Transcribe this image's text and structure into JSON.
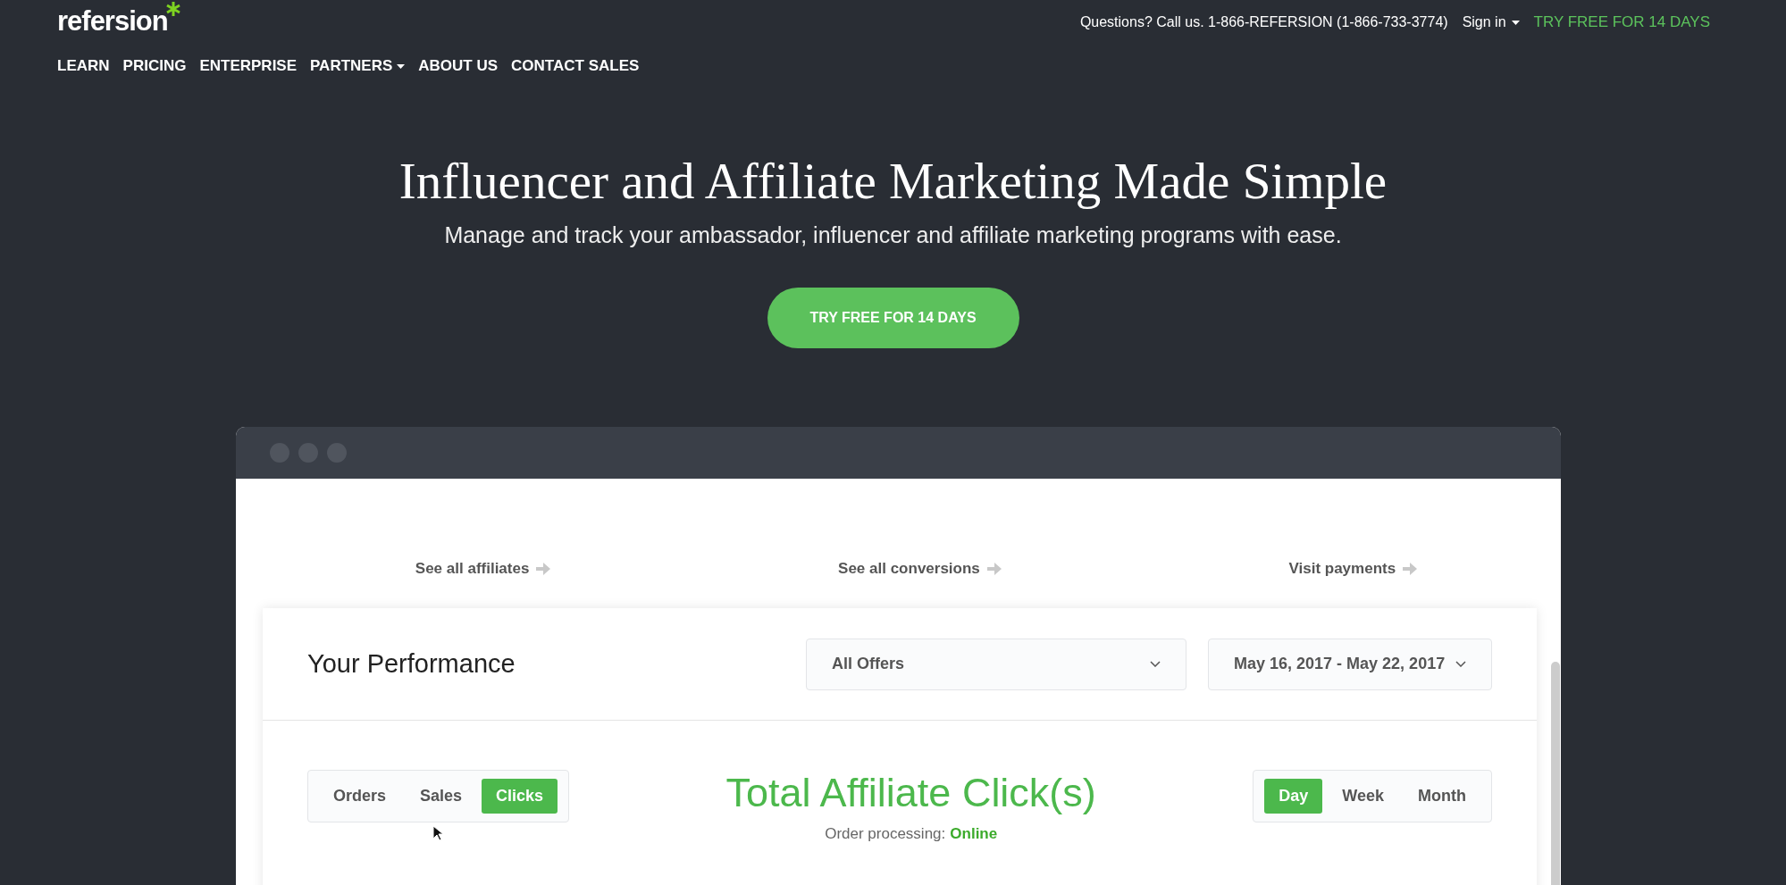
{
  "header": {
    "logo": "refersion",
    "contact": "Questions? Call us. 1-866-REFERSION (1-866-733-3774)",
    "sign_in": "Sign in",
    "cta": "TRY FREE FOR 14 DAYS"
  },
  "nav": [
    {
      "label": "LEARN",
      "dropdown": false
    },
    {
      "label": "PRICING",
      "dropdown": false
    },
    {
      "label": "ENTERPRISE",
      "dropdown": false
    },
    {
      "label": "PARTNERS",
      "dropdown": true
    },
    {
      "label": "ABOUT US",
      "dropdown": false
    },
    {
      "label": "CONTACT SALES",
      "dropdown": false
    }
  ],
  "hero": {
    "title": "Influencer and Affiliate Marketing Made Simple",
    "subtitle": "Manage and track your ambassador, influencer and affiliate marketing programs with ease.",
    "button": "TRY FREE FOR 14 DAYS"
  },
  "app_window": {
    "links": [
      "See all affiliates",
      "See all conversions",
      "Visit payments"
    ],
    "performance": {
      "title": "Your Performance",
      "offer_select": "All Offers",
      "date_select": "May 16, 2017 - May 22, 2017",
      "metric_tabs": [
        {
          "label": "Orders",
          "selected": false
        },
        {
          "label": "Sales",
          "selected": false
        },
        {
          "label": "Clicks",
          "selected": true
        }
      ],
      "chart_title": "Total Affiliate Click(s)",
      "processing_label": "Order processing:",
      "processing_status": "Online",
      "period_tabs": [
        {
          "label": "Day",
          "selected": true
        },
        {
          "label": "Week",
          "selected": false
        },
        {
          "label": "Month",
          "selected": false
        }
      ]
    }
  }
}
